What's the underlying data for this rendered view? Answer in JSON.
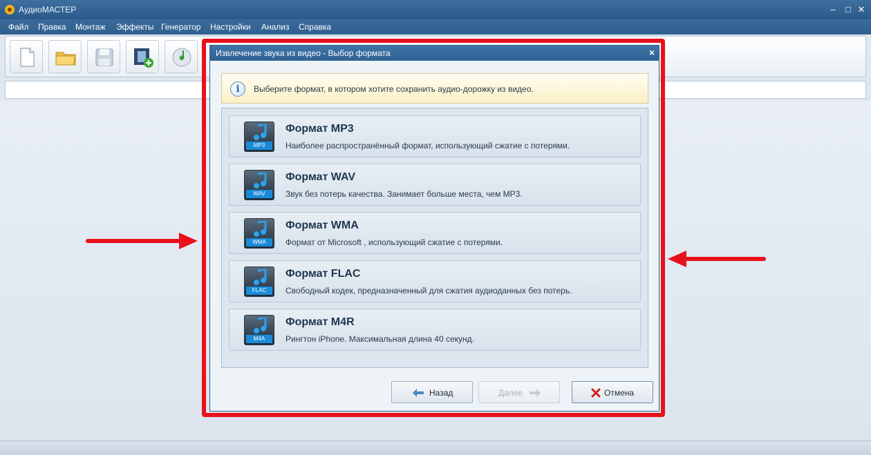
{
  "app": {
    "title": "АудиоМАСТЕР"
  },
  "menu": [
    "Файл",
    "Правка",
    "Монтаж",
    "Эффекты",
    "Генератор",
    "Настройки",
    "Анализ",
    "Справка"
  ],
  "dialog": {
    "title": "Извлечение звука из видео - Выбор формата",
    "close": "×",
    "info_text": "Выберите формат, в котором хотите сохранить аудио-дорожку из видео.",
    "info_icon": "i",
    "formats": [
      {
        "name": "Формат MP3",
        "desc": "Наиболее распространённый формат, использующий сжатие с потерями.",
        "ext": "MP3"
      },
      {
        "name": "Формат WAV",
        "desc": "Звук без потерь качества. Занимает больше места, чем MP3.",
        "ext": "WAV"
      },
      {
        "name": "Формат WMA",
        "desc": "Формат от Microsoft , использующий сжатие с потерями.",
        "ext": "WMA"
      },
      {
        "name": "Формат FLAC",
        "desc": "Свободный кодек, предназначенный для сжатия аудиоданных без потерь.",
        "ext": "FLAC"
      },
      {
        "name": "Формат M4R",
        "desc": "Рингтон iPhone. Максимальная длина 40 секунд.",
        "ext": "M4A"
      }
    ],
    "buttons": {
      "back": "Назад",
      "next": "Далее",
      "cancel": "Отмена"
    }
  },
  "colors": {
    "highlight": "#e8111b",
    "titlebar": "#2b5a8a",
    "accent": "#1a8bd8"
  }
}
